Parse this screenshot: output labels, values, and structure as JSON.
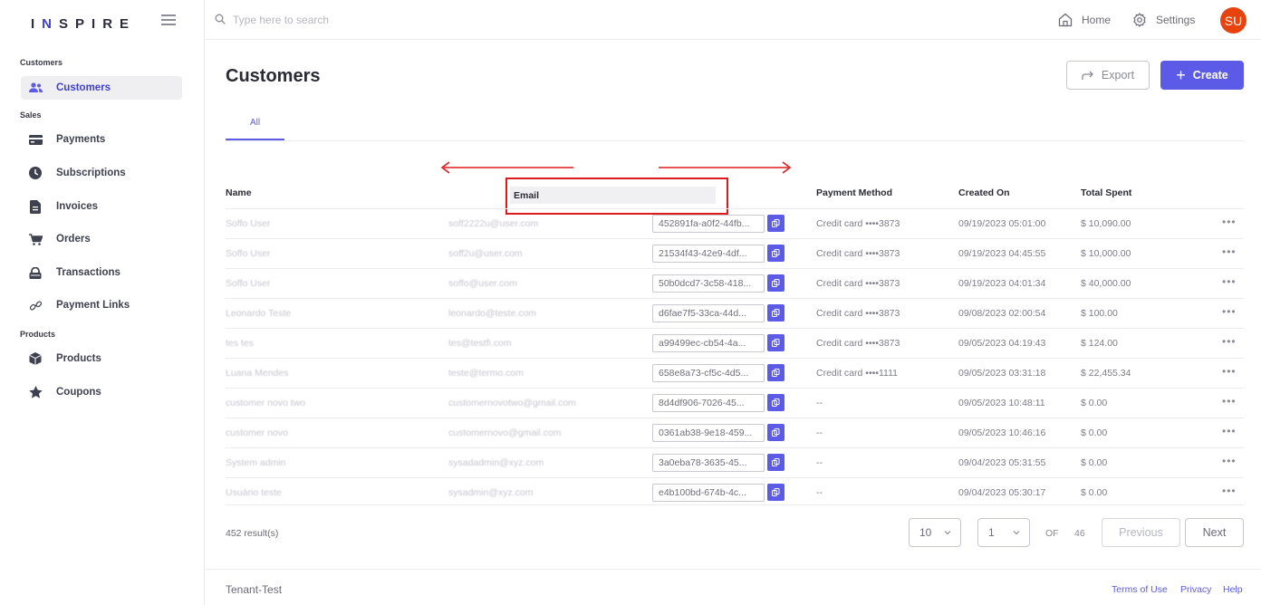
{
  "sidebar": {
    "logo": {
      "part1": "I",
      "accent": "N",
      "part2": "SPIRE"
    },
    "groups": {
      "customers": "Customers",
      "sales": "Sales",
      "products": "Products"
    },
    "items": [
      {
        "label": "Customers",
        "icon": "users-icon"
      },
      {
        "label": "Payments",
        "icon": "credit-card-icon"
      },
      {
        "label": "Subscriptions",
        "icon": "clock-icon"
      },
      {
        "label": "Invoices",
        "icon": "file-icon"
      },
      {
        "label": "Orders",
        "icon": "cart-icon"
      },
      {
        "label": "Transactions",
        "icon": "lock-icon"
      },
      {
        "label": "Payment Links",
        "icon": "link-icon"
      },
      {
        "label": "Products",
        "icon": "box-icon"
      },
      {
        "label": "Coupons",
        "icon": "star-icon"
      }
    ]
  },
  "topbar": {
    "search_placeholder": "Type here to search",
    "home": "Home",
    "settings": "Settings",
    "avatar": "SU"
  },
  "main": {
    "title": "Customers",
    "export_label": "Export",
    "create_label": "Create",
    "tab_all": "All",
    "columns": {
      "name": "Name",
      "email": "Email",
      "payment_method": "Payment Method",
      "created_on": "Created On",
      "total_spent": "Total Spent"
    },
    "rows": [
      {
        "name": "Soffo User",
        "email": "soff2222u@user.com",
        "id": "452891fa-a0f2-44fb...",
        "payment": "Credit card ••••3873",
        "created": "09/19/2023 05:01:00",
        "spent": "$ 10,090.00"
      },
      {
        "name": "Soffo User",
        "email": "soff2u@user.com",
        "id": "21534f43-42e9-4df...",
        "payment": "Credit card ••••3873",
        "created": "09/19/2023 04:45:55",
        "spent": "$ 10,000.00"
      },
      {
        "name": "Soffo User",
        "email": "soffo@user.com",
        "id": "50b0dcd7-3c58-418...",
        "payment": "Credit card ••••3873",
        "created": "09/19/2023 04:01:34",
        "spent": "$ 40,000.00"
      },
      {
        "name": "Leonardo Teste",
        "email": "leonardo@teste.com",
        "id": "d6fae7f5-33ca-44d...",
        "payment": "Credit card ••••3873",
        "created": "09/08/2023 02:00:54",
        "spent": "$ 100.00"
      },
      {
        "name": "tes tes",
        "email": "tes@testfi.com",
        "id": "a99499ec-cb54-4a...",
        "payment": "Credit card ••••3873",
        "created": "09/05/2023 04:19:43",
        "spent": "$ 124.00"
      },
      {
        "name": "Luana Mendes",
        "email": "teste@termo.com",
        "id": "658e8a73-cf5c-4d5...",
        "payment": "Credit card ••••1111",
        "created": "09/05/2023 03:31:18",
        "spent": "$ 22,455.34"
      },
      {
        "name": "customer novo two",
        "email": "customernovotwo@gmail.com",
        "id": "8d4df906-7026-45...",
        "payment": "--",
        "created": "09/05/2023 10:48:11",
        "spent": "$ 0.00"
      },
      {
        "name": "customer novo",
        "email": "customernovo@gmail.com",
        "id": "0361ab38-9e18-459...",
        "payment": "--",
        "created": "09/05/2023 10:46:16",
        "spent": "$ 0.00"
      },
      {
        "name": "System admin",
        "email": "sysadadmin@xyz.com",
        "id": "3a0eba78-3635-45...",
        "payment": "--",
        "created": "09/04/2023 05:31:55",
        "spent": "$ 0.00"
      },
      {
        "name": "Usuário teste",
        "email": "sysadmin@xyz.com",
        "id": "e4b100bd-674b-4c...",
        "payment": "--",
        "created": "09/04/2023 05:30:17",
        "spent": "$ 0.00"
      }
    ],
    "results": "452 result(s)",
    "page_size": "10",
    "page": "1",
    "of": "OF",
    "total_pages": "46",
    "previous": "Previous",
    "next": "Next"
  },
  "footer": {
    "tenant": "Tenant-Test",
    "terms": "Terms of Use",
    "privacy": "Privacy",
    "help": "Help"
  },
  "colors": {
    "accent": "#5b5be8",
    "annotation": "#e0191c",
    "avatar": "#e8430f"
  }
}
